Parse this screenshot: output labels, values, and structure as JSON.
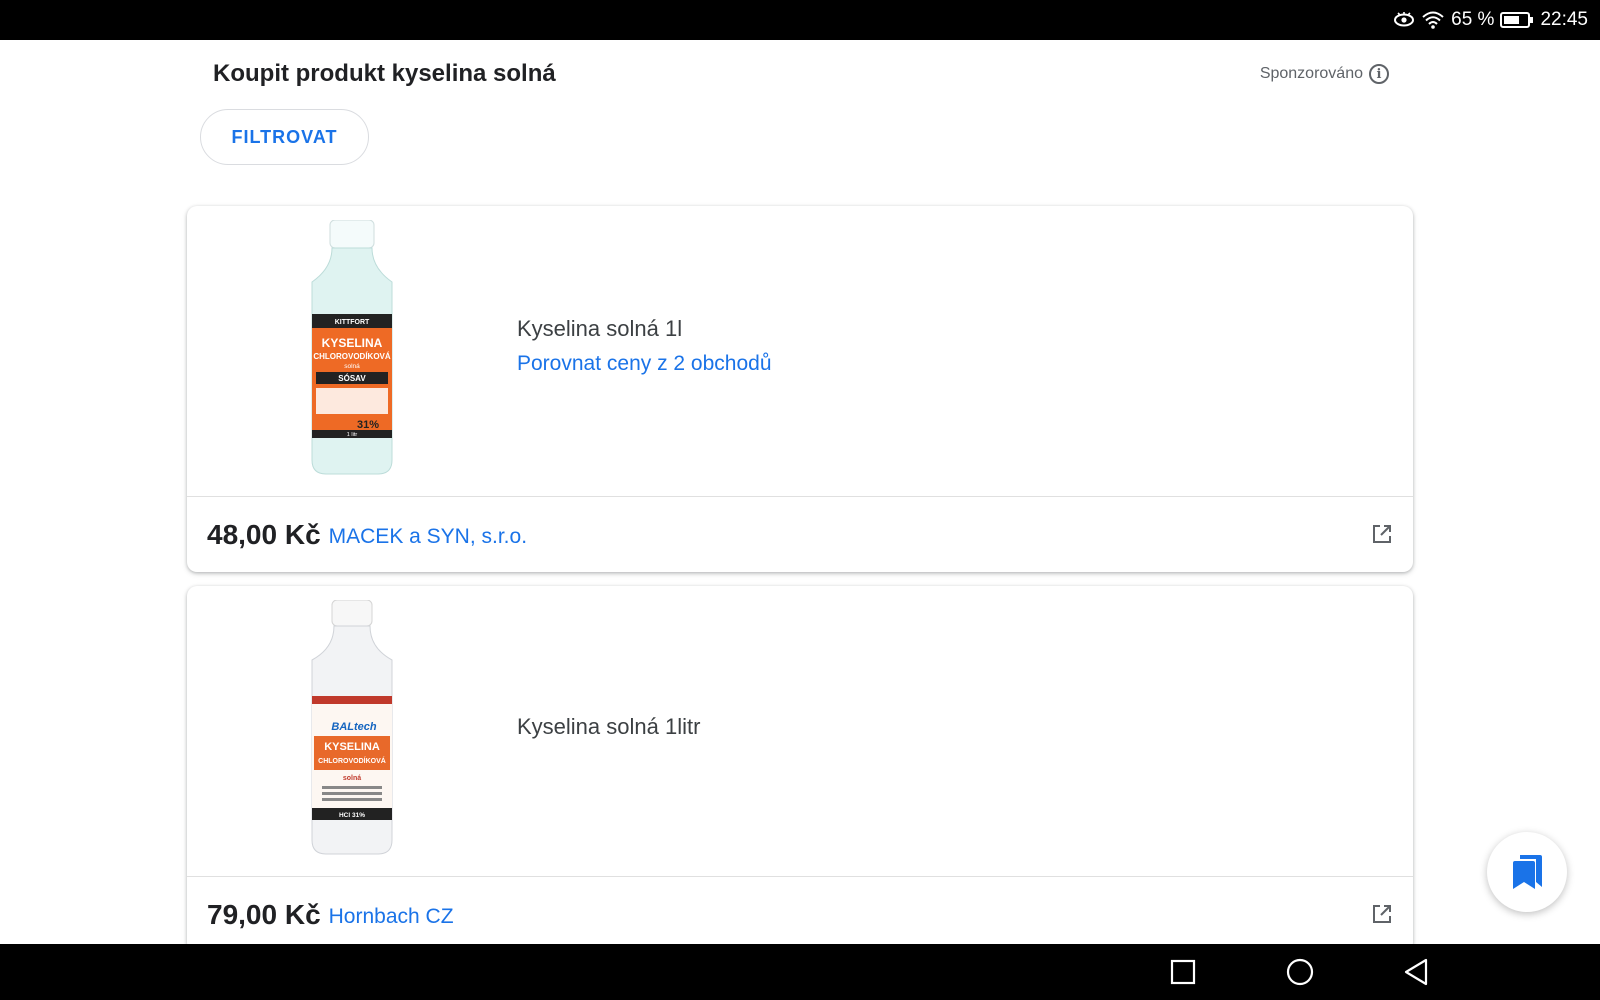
{
  "statusbar": {
    "battery": "65 %",
    "time": "22:45"
  },
  "header": {
    "title": "Koupit produkt kyselina solná",
    "sponsored": "Sponzorováno",
    "filter_label": "FILTROVAT"
  },
  "products": [
    {
      "name": "Kyselina solná 1l",
      "compare": "Porovnat ceny z 2 obchodů",
      "price": "48,00 Kč",
      "merchant": "MACEK a SYN, s.r.o.",
      "label_brand": "KITTFORT",
      "label_title": "KYSELINA",
      "label_sub": "CHLOROVODÍKOVÁ",
      "label_small": "solná",
      "label_extra": "SÓSAV",
      "label_pct": "31%",
      "label_vol": "1 litr"
    },
    {
      "name": "Kyselina solná 1litr",
      "price": "79,00 Kč",
      "merchant": "Hornbach CZ",
      "label_brand": "BALtech",
      "label_title": "KYSELINA",
      "label_sub": "CHLOROVODÍKOVÁ",
      "label_small": "solná",
      "label_pct": "HCl 31%"
    }
  ],
  "colors": {
    "accent": "#1a73e8",
    "text": "#202124",
    "fab_icon": "#1a73e8"
  }
}
